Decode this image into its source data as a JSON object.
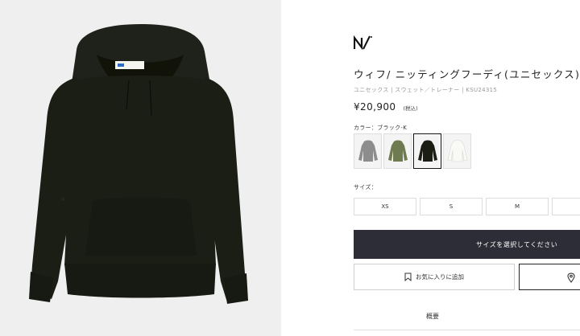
{
  "product": {
    "title": "ウィフ/ ニッティングフーディ(ユニセックス)",
    "meta": "ユニセックス | スウェット／トレーナー | KSU24315",
    "price": "¥20,900",
    "tax_note": "(税込)",
    "image_icon": "black-knit-hoodie-photo"
  },
  "color": {
    "label": "カラー：ブラック-K",
    "swatches": [
      {
        "name": "gray",
        "color": "#8d8d8d"
      },
      {
        "name": "khaki",
        "color": "#6e7a50"
      },
      {
        "name": "black",
        "color": "#1b1e15",
        "selected": true
      },
      {
        "name": "white",
        "color": "#f0efea"
      }
    ]
  },
  "size": {
    "label": "サイズ：",
    "options": [
      "XS",
      "S",
      "M",
      ""
    ]
  },
  "actions": {
    "cart_label": "サイズを選択してください",
    "favorite_label": "お気に入りに追加",
    "favorite_icon": "bookmark-icon",
    "store_icon": "location-pin-icon"
  },
  "tabs": {
    "overview": "概要"
  },
  "colors": {
    "background": "#efefef",
    "hoodie": "#1b1e15",
    "cart_button": "#2d2d37"
  }
}
